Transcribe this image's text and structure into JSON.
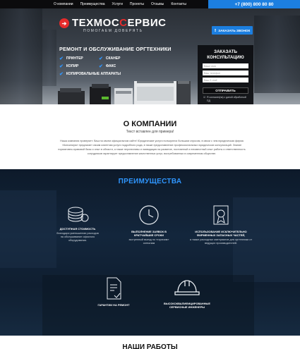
{
  "nav": {
    "links": [
      "О компании",
      "Преимущества",
      "Услуги",
      "Проекты",
      "Отзывы",
      "Контакты"
    ],
    "phone": "+7 (800) 800 80 80"
  },
  "header": {
    "logo_part1": "ТЕХМОС",
    "logo_part2": "С",
    "logo_part3": "ЕРВИС",
    "tagline": "ПОМОГАЕМ ДОВЕРЯТЬ",
    "call_button": "ЗАКАЗАТЬ ЗВОНОК"
  },
  "hero": {
    "title": "РЕМОНТ И ОБСЛУЖИВАНИЕ ОРГТЕХНИКИ",
    "features": [
      "ПРИНТЕР",
      "СКАНЕР",
      "КОПИР",
      "ФАКС",
      "КОПИРОВАЛЬНЫЕ АППАРАТЫ"
    ]
  },
  "form": {
    "title_line1": "ЗАКАЗАТЬ",
    "title_line2": "КОНСУЛЬТАЦИЮ",
    "name_placeholder": "Ваше имя",
    "phone_placeholder": "Ваш телефон",
    "email_placeholder": "Ваш E-mail",
    "submit": "ОТПРАВИТЬ",
    "consent": "Я согласен(на) с даной обработкой ПД"
  },
  "about": {
    "title": "О КОМПАНИИ",
    "subtitle": "Текст вставлен для примера!",
    "text": "Наша компания проверяет: Ваш на своем официальном сайте! Юридические услуги пользуются большим спросом, в связи с чем юридическая фирма «Консилиум» предлагает своим клиентам услуги подробного рода, в также предоставление профессиональных юридических консультаций. Знание нормативно-правовой базы и опыт в области, а также перспективы и ликвидация на развитие, постоянный и неизвестный опыт работы и ответственность сотрудников гарантирует предоставление качественных услуг, востребованных в современном обществе."
  },
  "advantages": {
    "title": "ПРЕИМУЩЕСТВА",
    "items": [
      {
        "label": "ДОСТУПНАЯ СТОИМОСТЬ",
        "desc": "благодаря уменьшению расходов на обслуживание офисного оборудования.",
        "icon": "coins-icon"
      },
      {
        "label": "ВЫПОЛНЕНИЕ ЗАЯВОК В КРАТЧАЙШИЕ СРОКИ",
        "desc": "экстренный выезд по «горячим» сигналам",
        "icon": "clock-icon"
      },
      {
        "label": "ИСПОЛЬЗОВАНИЕ ИСКЛЮЧИТЕЛЬНО ФИРМЕННЫХ ЗАПАСНЫХ ЧАСТЕЙ,",
        "desc": "а также расходных материалов для оргтехники от ведущих производителей.",
        "icon": "certificate-icon"
      },
      {
        "label": "ГАРАНТИИ НА РЕМОНТ",
        "desc": "",
        "icon": "document-check-icon"
      },
      {
        "label": "ВЫСОКОКВАЛИФИЦИРОВАННЫЕ СЕРВИСНЫЕ ИНЖЕНЕРЫ",
        "desc": "",
        "icon": "helmet-icon"
      }
    ]
  },
  "works": {
    "title": "НАШИ РАБОТЫ"
  },
  "colors": {
    "accent": "#1c7fe0",
    "brand_red": "#e52b2b",
    "dark": "#0b0b0d"
  }
}
